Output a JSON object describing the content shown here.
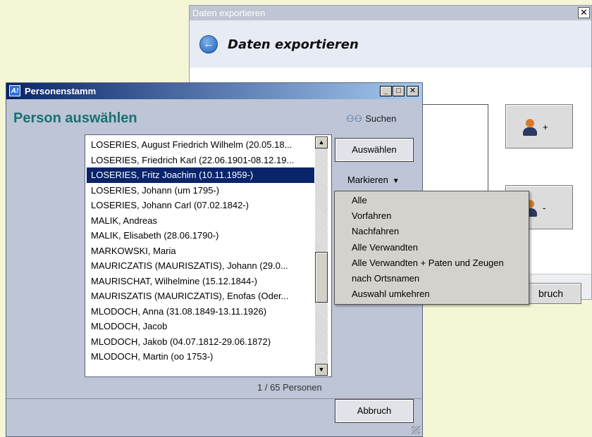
{
  "export_window": {
    "title": "Daten exportieren",
    "close_glyph": "✕",
    "back_icon": "back-arrow-icon",
    "heading": "Daten exportieren",
    "add_person_label": "+",
    "remove_person_label": "-",
    "cancel_label": "bruch"
  },
  "person_window": {
    "title": "Personenstamm",
    "app_icon_text": "A!",
    "min_glyph": "_",
    "max_glyph": "□",
    "close_glyph": "✕",
    "heading": "Person auswählen",
    "search_label": "Suchen",
    "search_icon": "binoculars-icon",
    "select_label": "Auswählen",
    "mark_label": "Markieren",
    "mark_caret": "▼",
    "count_label": "1 / 65 Personen",
    "cancel_label": "Abbruch",
    "scroll_up_glyph": "▲",
    "scroll_down_glyph": "▼",
    "list_items": [
      "LOSERIES, August Friedrich Wilhelm (20.05.18...",
      "LOSERIES, Friedrich Karl (22.06.1901-08.12.19...",
      "LOSERIES, Fritz Joachim (10.11.1959-)",
      "LOSERIES, Johann (um 1795-)",
      "LOSERIES, Johann Carl (07.02.1842-)",
      "MALIK, Andreas",
      "MALIK, Elisabeth (28.06.1790-)",
      "MARKOWSKI, Maria",
      "MAURICZATIS (MAURISZATIS), Johann (29.0...",
      "MAURISCHAT, Wilhelmine (15.12.1844-)",
      "MAURISZATIS (MAURICZATIS), Enofas (Oder...",
      "MLODOCH, Anna (31.08.1849-13.11.1926)",
      "MLODOCH, Jacob",
      "MLODOCH, Jakob (04.07.1812-29.06.1872)",
      "MLODOCH, Martin (oo 1753-)"
    ],
    "selected_index": 2
  },
  "mark_menu": {
    "items": [
      "Alle",
      "Vorfahren",
      "Nachfahren",
      "Alle Verwandten",
      "Alle Verwandten + Paten und Zeugen",
      "nach Ortsnamen",
      "Auswahl umkehren"
    ]
  },
  "colors": {
    "title_bar_start": "#0a246a",
    "title_bar_end": "#a6caf0",
    "heading_teal": "#1a7072",
    "selection": "#0a246a"
  }
}
